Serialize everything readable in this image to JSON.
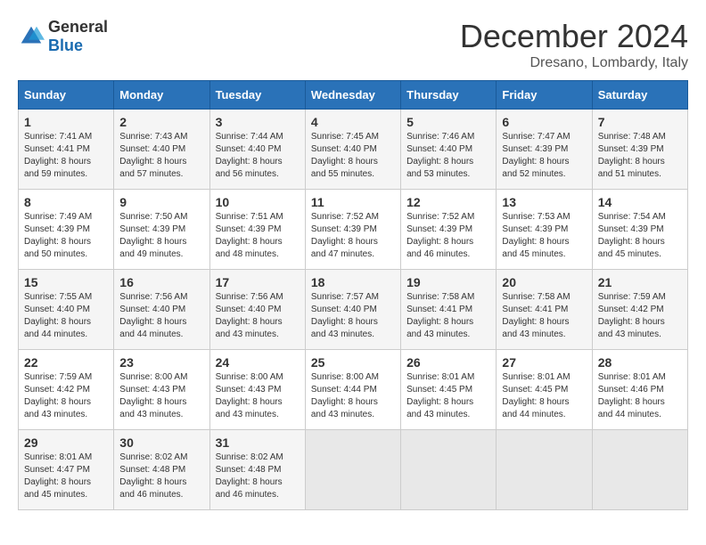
{
  "logo": {
    "general": "General",
    "blue": "Blue"
  },
  "title": "December 2024",
  "location": "Dresano, Lombardy, Italy",
  "days_of_week": [
    "Sunday",
    "Monday",
    "Tuesday",
    "Wednesday",
    "Thursday",
    "Friday",
    "Saturday"
  ],
  "weeks": [
    [
      {
        "day": "1",
        "sunrise": "Sunrise: 7:41 AM",
        "sunset": "Sunset: 4:41 PM",
        "daylight": "Daylight: 8 hours and 59 minutes."
      },
      {
        "day": "2",
        "sunrise": "Sunrise: 7:43 AM",
        "sunset": "Sunset: 4:40 PM",
        "daylight": "Daylight: 8 hours and 57 minutes."
      },
      {
        "day": "3",
        "sunrise": "Sunrise: 7:44 AM",
        "sunset": "Sunset: 4:40 PM",
        "daylight": "Daylight: 8 hours and 56 minutes."
      },
      {
        "day": "4",
        "sunrise": "Sunrise: 7:45 AM",
        "sunset": "Sunset: 4:40 PM",
        "daylight": "Daylight: 8 hours and 55 minutes."
      },
      {
        "day": "5",
        "sunrise": "Sunrise: 7:46 AM",
        "sunset": "Sunset: 4:40 PM",
        "daylight": "Daylight: 8 hours and 53 minutes."
      },
      {
        "day": "6",
        "sunrise": "Sunrise: 7:47 AM",
        "sunset": "Sunset: 4:39 PM",
        "daylight": "Daylight: 8 hours and 52 minutes."
      },
      {
        "day": "7",
        "sunrise": "Sunrise: 7:48 AM",
        "sunset": "Sunset: 4:39 PM",
        "daylight": "Daylight: 8 hours and 51 minutes."
      }
    ],
    [
      {
        "day": "8",
        "sunrise": "Sunrise: 7:49 AM",
        "sunset": "Sunset: 4:39 PM",
        "daylight": "Daylight: 8 hours and 50 minutes."
      },
      {
        "day": "9",
        "sunrise": "Sunrise: 7:50 AM",
        "sunset": "Sunset: 4:39 PM",
        "daylight": "Daylight: 8 hours and 49 minutes."
      },
      {
        "day": "10",
        "sunrise": "Sunrise: 7:51 AM",
        "sunset": "Sunset: 4:39 PM",
        "daylight": "Daylight: 8 hours and 48 minutes."
      },
      {
        "day": "11",
        "sunrise": "Sunrise: 7:52 AM",
        "sunset": "Sunset: 4:39 PM",
        "daylight": "Daylight: 8 hours and 47 minutes."
      },
      {
        "day": "12",
        "sunrise": "Sunrise: 7:52 AM",
        "sunset": "Sunset: 4:39 PM",
        "daylight": "Daylight: 8 hours and 46 minutes."
      },
      {
        "day": "13",
        "sunrise": "Sunrise: 7:53 AM",
        "sunset": "Sunset: 4:39 PM",
        "daylight": "Daylight: 8 hours and 45 minutes."
      },
      {
        "day": "14",
        "sunrise": "Sunrise: 7:54 AM",
        "sunset": "Sunset: 4:39 PM",
        "daylight": "Daylight: 8 hours and 45 minutes."
      }
    ],
    [
      {
        "day": "15",
        "sunrise": "Sunrise: 7:55 AM",
        "sunset": "Sunset: 4:40 PM",
        "daylight": "Daylight: 8 hours and 44 minutes."
      },
      {
        "day": "16",
        "sunrise": "Sunrise: 7:56 AM",
        "sunset": "Sunset: 4:40 PM",
        "daylight": "Daylight: 8 hours and 44 minutes."
      },
      {
        "day": "17",
        "sunrise": "Sunrise: 7:56 AM",
        "sunset": "Sunset: 4:40 PM",
        "daylight": "Daylight: 8 hours and 43 minutes."
      },
      {
        "day": "18",
        "sunrise": "Sunrise: 7:57 AM",
        "sunset": "Sunset: 4:40 PM",
        "daylight": "Daylight: 8 hours and 43 minutes."
      },
      {
        "day": "19",
        "sunrise": "Sunrise: 7:58 AM",
        "sunset": "Sunset: 4:41 PM",
        "daylight": "Daylight: 8 hours and 43 minutes."
      },
      {
        "day": "20",
        "sunrise": "Sunrise: 7:58 AM",
        "sunset": "Sunset: 4:41 PM",
        "daylight": "Daylight: 8 hours and 43 minutes."
      },
      {
        "day": "21",
        "sunrise": "Sunrise: 7:59 AM",
        "sunset": "Sunset: 4:42 PM",
        "daylight": "Daylight: 8 hours and 43 minutes."
      }
    ],
    [
      {
        "day": "22",
        "sunrise": "Sunrise: 7:59 AM",
        "sunset": "Sunset: 4:42 PM",
        "daylight": "Daylight: 8 hours and 43 minutes."
      },
      {
        "day": "23",
        "sunrise": "Sunrise: 8:00 AM",
        "sunset": "Sunset: 4:43 PM",
        "daylight": "Daylight: 8 hours and 43 minutes."
      },
      {
        "day": "24",
        "sunrise": "Sunrise: 8:00 AM",
        "sunset": "Sunset: 4:43 PM",
        "daylight": "Daylight: 8 hours and 43 minutes."
      },
      {
        "day": "25",
        "sunrise": "Sunrise: 8:00 AM",
        "sunset": "Sunset: 4:44 PM",
        "daylight": "Daylight: 8 hours and 43 minutes."
      },
      {
        "day": "26",
        "sunrise": "Sunrise: 8:01 AM",
        "sunset": "Sunset: 4:45 PM",
        "daylight": "Daylight: 8 hours and 43 minutes."
      },
      {
        "day": "27",
        "sunrise": "Sunrise: 8:01 AM",
        "sunset": "Sunset: 4:45 PM",
        "daylight": "Daylight: 8 hours and 44 minutes."
      },
      {
        "day": "28",
        "sunrise": "Sunrise: 8:01 AM",
        "sunset": "Sunset: 4:46 PM",
        "daylight": "Daylight: 8 hours and 44 minutes."
      }
    ],
    [
      {
        "day": "29",
        "sunrise": "Sunrise: 8:01 AM",
        "sunset": "Sunset: 4:47 PM",
        "daylight": "Daylight: 8 hours and 45 minutes."
      },
      {
        "day": "30",
        "sunrise": "Sunrise: 8:02 AM",
        "sunset": "Sunset: 4:48 PM",
        "daylight": "Daylight: 8 hours and 46 minutes."
      },
      {
        "day": "31",
        "sunrise": "Sunrise: 8:02 AM",
        "sunset": "Sunset: 4:48 PM",
        "daylight": "Daylight: 8 hours and 46 minutes."
      },
      null,
      null,
      null,
      null
    ]
  ]
}
